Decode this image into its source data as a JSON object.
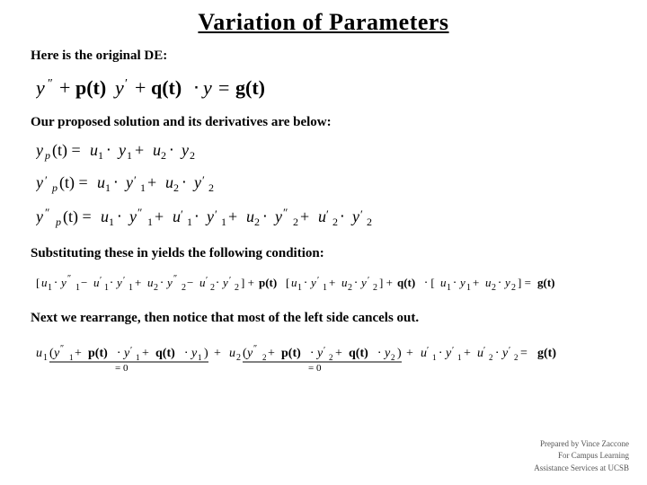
{
  "title": "Variation of Parameters",
  "section1_label": "Here is the original DE:",
  "section2_label": "Our proposed solution and its derivatives are below:",
  "section3_label": "Substituting these in yields the following condition:",
  "section4_label": "Next we rearrange, then notice that most of the left side cancels out.",
  "footer": {
    "line1": "Prepared by Vince Zaccone",
    "line2": "For Campus Learning",
    "line3": "Assistance Services at UCSB"
  }
}
